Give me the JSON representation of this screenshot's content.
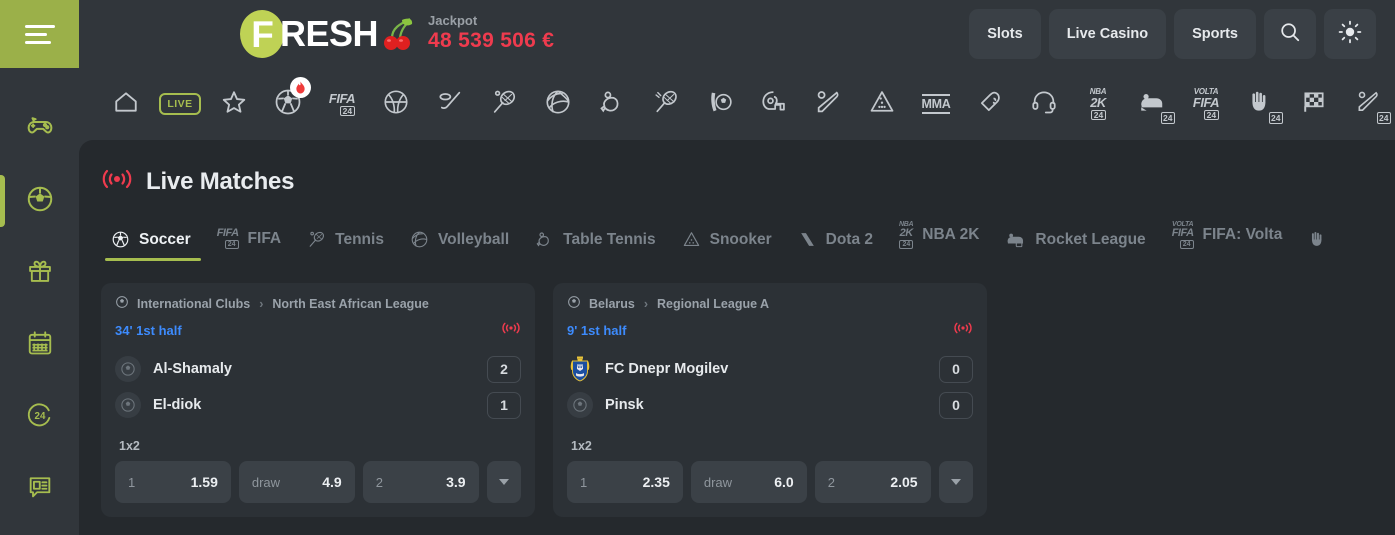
{
  "brand": {
    "logo_letter": "F",
    "logo_text": "RESH",
    "cherries_icon": "cherries-icon"
  },
  "jackpot": {
    "label": "Jackpot",
    "value": "48 539 506 €"
  },
  "header": {
    "menu_icon": "hamburger-icon",
    "nav": [
      {
        "label": "Slots",
        "name": "nav-slots"
      },
      {
        "label": "Live Casino",
        "name": "nav-live-casino"
      },
      {
        "label": "Sports",
        "name": "nav-sports"
      }
    ],
    "search_icon": "search-icon",
    "theme_icon": "sun-icon"
  },
  "sidebar": {
    "items": [
      {
        "name": "sidebar-item-games",
        "icon": "gamepad-icon",
        "active": false
      },
      {
        "name": "sidebar-item-sports",
        "icon": "soccer-globe-icon",
        "active": true
      },
      {
        "name": "sidebar-item-promotions",
        "icon": "gift-icon",
        "active": false
      },
      {
        "name": "sidebar-item-calendar",
        "icon": "calendar-icon",
        "active": false
      },
      {
        "name": "sidebar-item-support-24",
        "icon": "24-support-icon",
        "active": false
      },
      {
        "name": "sidebar-item-news",
        "icon": "news-chat-icon",
        "active": false
      }
    ]
  },
  "sports_rail": {
    "items": [
      {
        "name": "rail-home",
        "icon": "home-icon",
        "label": ""
      },
      {
        "name": "rail-live",
        "icon": "live-pill-icon",
        "label": "LIVE"
      },
      {
        "name": "rail-favorites",
        "icon": "star-icon",
        "label": ""
      },
      {
        "name": "rail-soccer",
        "icon": "soccer-ball-icon",
        "label": "",
        "badge": "flame-badge"
      },
      {
        "name": "rail-fifa",
        "icon": "fifa-24-icon",
        "label": "FIFA"
      },
      {
        "name": "rail-basketball",
        "icon": "basketball-icon",
        "label": ""
      },
      {
        "name": "rail-ice-hockey",
        "icon": "ice-hockey-icon",
        "label": ""
      },
      {
        "name": "rail-tennis",
        "icon": "tennis-racket-icon",
        "label": ""
      },
      {
        "name": "rail-volleyball",
        "icon": "volleyball-icon",
        "label": ""
      },
      {
        "name": "rail-table-tennis",
        "icon": "table-tennis-icon",
        "label": ""
      },
      {
        "name": "rail-badminton",
        "icon": "badminton-icon",
        "label": ""
      },
      {
        "name": "rail-futsal",
        "icon": "futsal-icon",
        "label": ""
      },
      {
        "name": "rail-american-football",
        "icon": "american-football-helmet-icon",
        "label": ""
      },
      {
        "name": "rail-baseball",
        "icon": "baseball-bat-icon",
        "label": ""
      },
      {
        "name": "rail-snooker",
        "icon": "snooker-rack-icon",
        "label": ""
      },
      {
        "name": "rail-mma",
        "icon": "mma-icon",
        "label": "MMA"
      },
      {
        "name": "rail-boxing",
        "icon": "boxing-glove-icon",
        "label": ""
      },
      {
        "name": "rail-esports",
        "icon": "headset-icon",
        "label": ""
      },
      {
        "name": "rail-nba-2k",
        "icon": "nba-2k-24-icon",
        "label": "NBA 2K"
      },
      {
        "name": "rail-rocket-league",
        "icon": "rocket-league-24-icon",
        "label": ""
      },
      {
        "name": "rail-fifa-volta",
        "icon": "volta-fifa-24-icon",
        "label": "VOLTA FIFA"
      },
      {
        "name": "rail-handball",
        "icon": "handball-24-icon",
        "label": ""
      },
      {
        "name": "rail-motorsport",
        "icon": "checkered-flag-icon",
        "label": ""
      },
      {
        "name": "rail-cricket",
        "icon": "cricket-24-icon",
        "label": ""
      }
    ]
  },
  "main": {
    "title": "Live Matches",
    "title_icon": "live-broadcast-icon",
    "tabs": [
      {
        "label": "Soccer",
        "icon": "soccer-ball-icon",
        "active": true
      },
      {
        "label": "FIFA",
        "icon": "fifa-24-icon",
        "active": false
      },
      {
        "label": "Tennis",
        "icon": "tennis-racket-icon",
        "active": false
      },
      {
        "label": "Volleyball",
        "icon": "volleyball-icon",
        "active": false
      },
      {
        "label": "Table Tennis",
        "icon": "table-tennis-icon",
        "active": false
      },
      {
        "label": "Snooker",
        "icon": "snooker-rack-icon",
        "active": false
      },
      {
        "label": "Dota 2",
        "icon": "dota-2-icon",
        "active": false
      },
      {
        "label": "NBA 2K",
        "icon": "nba-2k-24-icon",
        "active": false
      },
      {
        "label": "Rocket League",
        "icon": "rocket-league-24-icon",
        "active": false
      },
      {
        "label": "FIFA: Volta",
        "icon": "volta-fifa-24-icon",
        "active": false
      },
      {
        "label": "",
        "icon": "handball-24-icon",
        "active": false
      }
    ]
  },
  "matches": [
    {
      "country": "International Clubs",
      "league": "North East African League",
      "separator": "›",
      "time": "34' 1st half",
      "live_icon": "live-broadcast-icon",
      "teams": [
        {
          "name": "Al-Shamaly",
          "score": "2",
          "logo": "soccer-ball-placeholder-icon"
        },
        {
          "name": "El-diok",
          "score": "1",
          "logo": "soccer-ball-placeholder-icon"
        }
      ],
      "market": "1x2",
      "odds": [
        {
          "name": "1",
          "value": "1.59"
        },
        {
          "name": "draw",
          "value": "4.9"
        },
        {
          "name": "2",
          "value": "3.9"
        }
      ],
      "more_icon": "chevron-down-icon"
    },
    {
      "country": "Belarus",
      "league": "Regional League A",
      "separator": "›",
      "time": "9' 1st half",
      "live_icon": "live-broadcast-icon",
      "teams": [
        {
          "name": "FC Dnepr Mogilev",
          "score": "0",
          "logo": "dnepr-mogilev-crest-icon"
        },
        {
          "name": "Pinsk",
          "score": "0",
          "logo": "soccer-ball-placeholder-icon"
        }
      ],
      "market": "1x2",
      "odds": [
        {
          "name": "1",
          "value": "2.35"
        },
        {
          "name": "draw",
          "value": "6.0"
        },
        {
          "name": "2",
          "value": "2.05"
        }
      ],
      "more_icon": "chevron-down-icon"
    }
  ],
  "colors": {
    "accent_green": "#a6bd4f",
    "logo_green": "#bfd255",
    "jackpot_red": "#ef3b4e",
    "live_blue": "#3d8bfd",
    "page_bg": "#31363b",
    "panel_bg": "#25292d",
    "card_bg": "#2c3136"
  }
}
